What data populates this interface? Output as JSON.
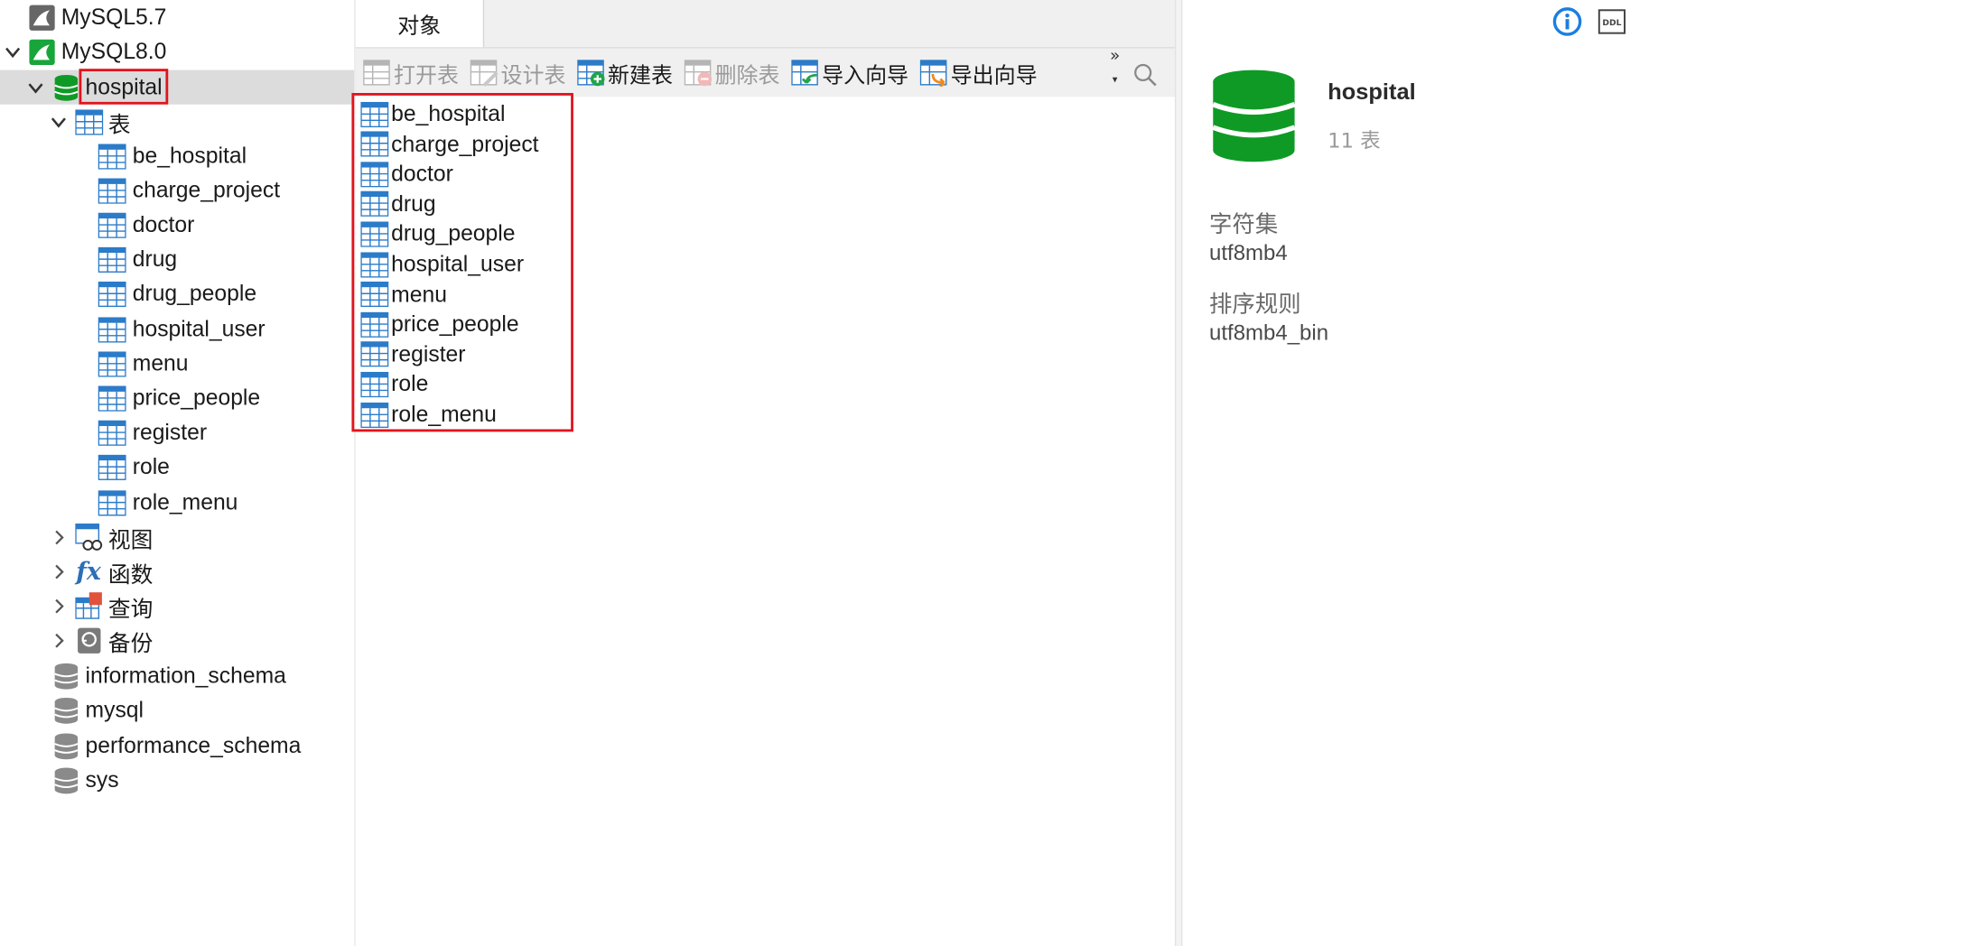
{
  "tree": {
    "connections": [
      {
        "label": "MySQL5.7",
        "icon": "mysql-connection-closed-icon"
      },
      {
        "label": "MySQL8.0",
        "icon": "mysql-connection-open-icon"
      }
    ],
    "selected_database": "hospital",
    "tables_group_label": "表",
    "tables": [
      "be_hospital",
      "charge_project",
      "doctor",
      "drug",
      "drug_people",
      "hospital_user",
      "menu",
      "price_people",
      "register",
      "role",
      "role_menu"
    ],
    "other_groups": [
      {
        "label": "视图",
        "icon": "view-icon"
      },
      {
        "label": "函数",
        "icon": "function-icon"
      },
      {
        "label": "查询",
        "icon": "query-icon"
      },
      {
        "label": "备份",
        "icon": "backup-icon"
      }
    ],
    "other_databases": [
      "information_schema",
      "mysql",
      "performance_schema",
      "sys"
    ]
  },
  "tabs": [
    {
      "label": "对象",
      "active": true
    }
  ],
  "toolbar": {
    "buttons": [
      {
        "label": "打开表",
        "enabled": false
      },
      {
        "label": "设计表",
        "enabled": false
      },
      {
        "label": "新建表",
        "enabled": true
      },
      {
        "label": "删除表",
        "enabled": false
      },
      {
        "label": "导入向导",
        "enabled": true
      },
      {
        "label": "导出向导",
        "enabled": true
      }
    ],
    "more_label": "»"
  },
  "objects": [
    "be_hospital",
    "charge_project",
    "doctor",
    "drug",
    "drug_people",
    "hospital_user",
    "menu",
    "price_people",
    "register",
    "role",
    "role_menu"
  ],
  "info": {
    "name": "hospital",
    "table_count": "11 表",
    "ddl_label": "DDL",
    "charset_label": "字符集",
    "charset_value": "utf8mb4",
    "collation_label": "排序规则",
    "collation_value": "utf8mb4_bin"
  },
  "colors": {
    "db_green": "#0f9a26",
    "highlight_red": "#e0141e",
    "table_icon_blue": "#2b7bc9",
    "info_blue": "#1a7fe0"
  }
}
